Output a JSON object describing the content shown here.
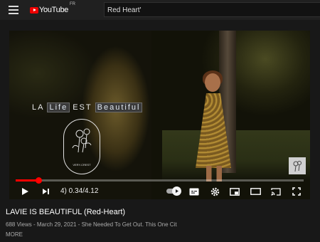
{
  "header": {
    "logo_text": "YouTube",
    "region": "FR",
    "search_value": "Red Heart'"
  },
  "player": {
    "overlay_title_words": [
      "LA",
      "Life",
      "EST",
      "Beautiful"
    ],
    "seal_text": "VERY-CREST",
    "progress_fraction": 0.08,
    "time_display": "4) 0.34/4.12",
    "autoplay_on": true
  },
  "video": {
    "title": "LAVIE IS BEAUTIFUL (Red-Heart)",
    "meta": "688 Views - March 29, 2021 - She Needed To Get Out. This One Cit",
    "more_label": "MORE"
  },
  "icons": {
    "menu": "menu-icon",
    "play": "play-icon",
    "next": "next-icon",
    "subtitles": "subtitles-icon",
    "settings": "gear-icon",
    "miniplayer": "miniplayer-icon",
    "theater": "theater-icon",
    "cast": "cast-icon",
    "fullscreen": "fullscreen-icon"
  },
  "colors": {
    "brand": "#ff0000",
    "background": "#181818"
  }
}
